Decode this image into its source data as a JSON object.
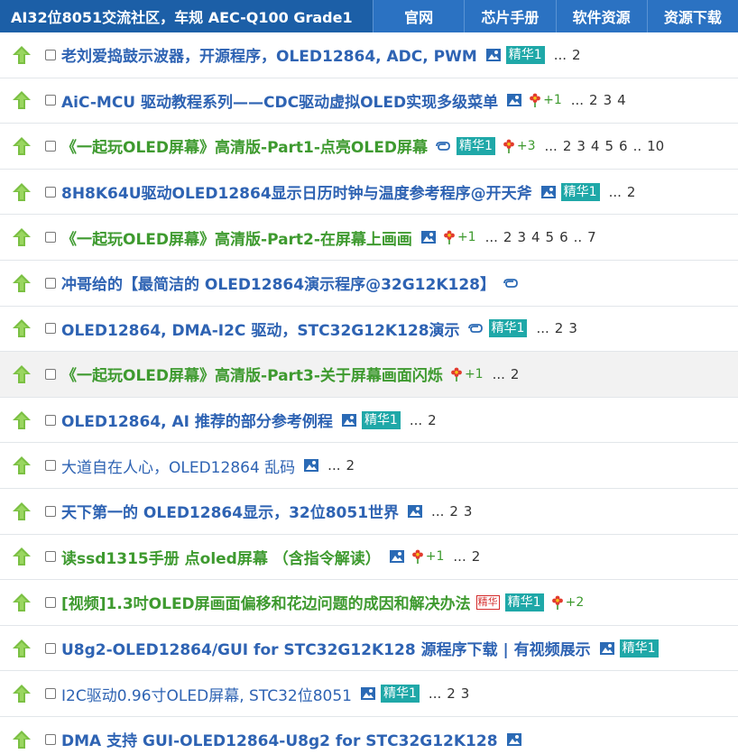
{
  "header": {
    "brand": "AI32位8051交流社区，车规 AEC-Q100 Grade1",
    "nav": [
      "官网",
      "芯片手册",
      "软件资源",
      "资源下载"
    ]
  },
  "threads": [
    {
      "title": "老刘爱捣鼓示波器，开源程序，OLED12864, ADC, PWM",
      "style": "blue",
      "image": true,
      "badge": "精华1",
      "pages": [
        "...",
        "2"
      ]
    },
    {
      "title": "AiC-MCU 驱动教程系列——CDC驱动虚拟OLED实现多级菜单",
      "style": "blue",
      "image": true,
      "flower": "+1",
      "pages": [
        "...",
        "2",
        "3",
        "4"
      ]
    },
    {
      "title": "《一起玩OLED屏幕》高清版-Part1-点亮OLED屏幕",
      "style": "green",
      "link": true,
      "badge": "精华1",
      "flower": "+3",
      "pages": [
        "...",
        "2",
        "3",
        "4",
        "5",
        "6",
        "..",
        "10"
      ]
    },
    {
      "title": "8H8K64U驱动OLED12864显示日历时钟与温度参考程序@开天斧",
      "style": "blue",
      "image": true,
      "badge": "精华1",
      "pages": [
        "...",
        "2"
      ]
    },
    {
      "title": "《一起玩OLED屏幕》高清版-Part2-在屏幕上画画",
      "style": "green",
      "image": true,
      "flower": "+1",
      "pages": [
        "...",
        "2",
        "3",
        "4",
        "5",
        "6",
        "..",
        "7"
      ]
    },
    {
      "title": "冲哥给的【最简洁的 OLED12864演示程序@32G12K128】",
      "style": "blue",
      "link": true,
      "pages": []
    },
    {
      "title": "OLED12864, DMA-I2C 驱动，STC32G12K128演示",
      "style": "blue",
      "link": true,
      "badge": "精华1",
      "pages": [
        "...",
        "2",
        "3"
      ]
    },
    {
      "title": "《一起玩OLED屏幕》高清版-Part3-关于屏幕画面闪烁",
      "style": "green",
      "flower": "+1",
      "pages": [
        "...",
        "2"
      ],
      "highlight": true
    },
    {
      "title": "OLED12864, AI 推荐的部分参考例程",
      "style": "blue",
      "image": true,
      "badge": "精华1",
      "pages": [
        "...",
        "2"
      ]
    },
    {
      "title": "大道自在人心，OLED12864 乱码",
      "style": "plain",
      "image": true,
      "pages": [
        "...",
        "2"
      ]
    },
    {
      "title": "天下第一的 OLED12864显示，32位8051世界",
      "style": "blue",
      "image": true,
      "pages": [
        "...",
        "2",
        "3"
      ]
    },
    {
      "title": "读ssd1315手册 点oled屏幕 （含指令解读）",
      "style": "green",
      "image": true,
      "flower": "+1",
      "pages": [
        "...",
        "2"
      ]
    },
    {
      "title": "[视频]1.3吋OLED屏画面偏移和花边问题的成因和解决办法",
      "style": "green",
      "seal": "精华",
      "badge": "精华1",
      "flower": "+2",
      "pages": []
    },
    {
      "title": "U8g2-OLED12864/GUI for STC32G12K128 源程序下载 | 有视频展示",
      "style": "blue",
      "image": true,
      "badge": "精华1",
      "pages": []
    },
    {
      "title": "I2C驱动0.96寸OLED屏幕, STC32位8051",
      "style": "plain",
      "image": true,
      "badge": "精华1",
      "pages": [
        "...",
        "2",
        "3"
      ]
    },
    {
      "title": "DMA 支持 GUI-OLED12864-U8g2 for STC32G12K128",
      "style": "blue",
      "image": true,
      "pages": []
    }
  ]
}
